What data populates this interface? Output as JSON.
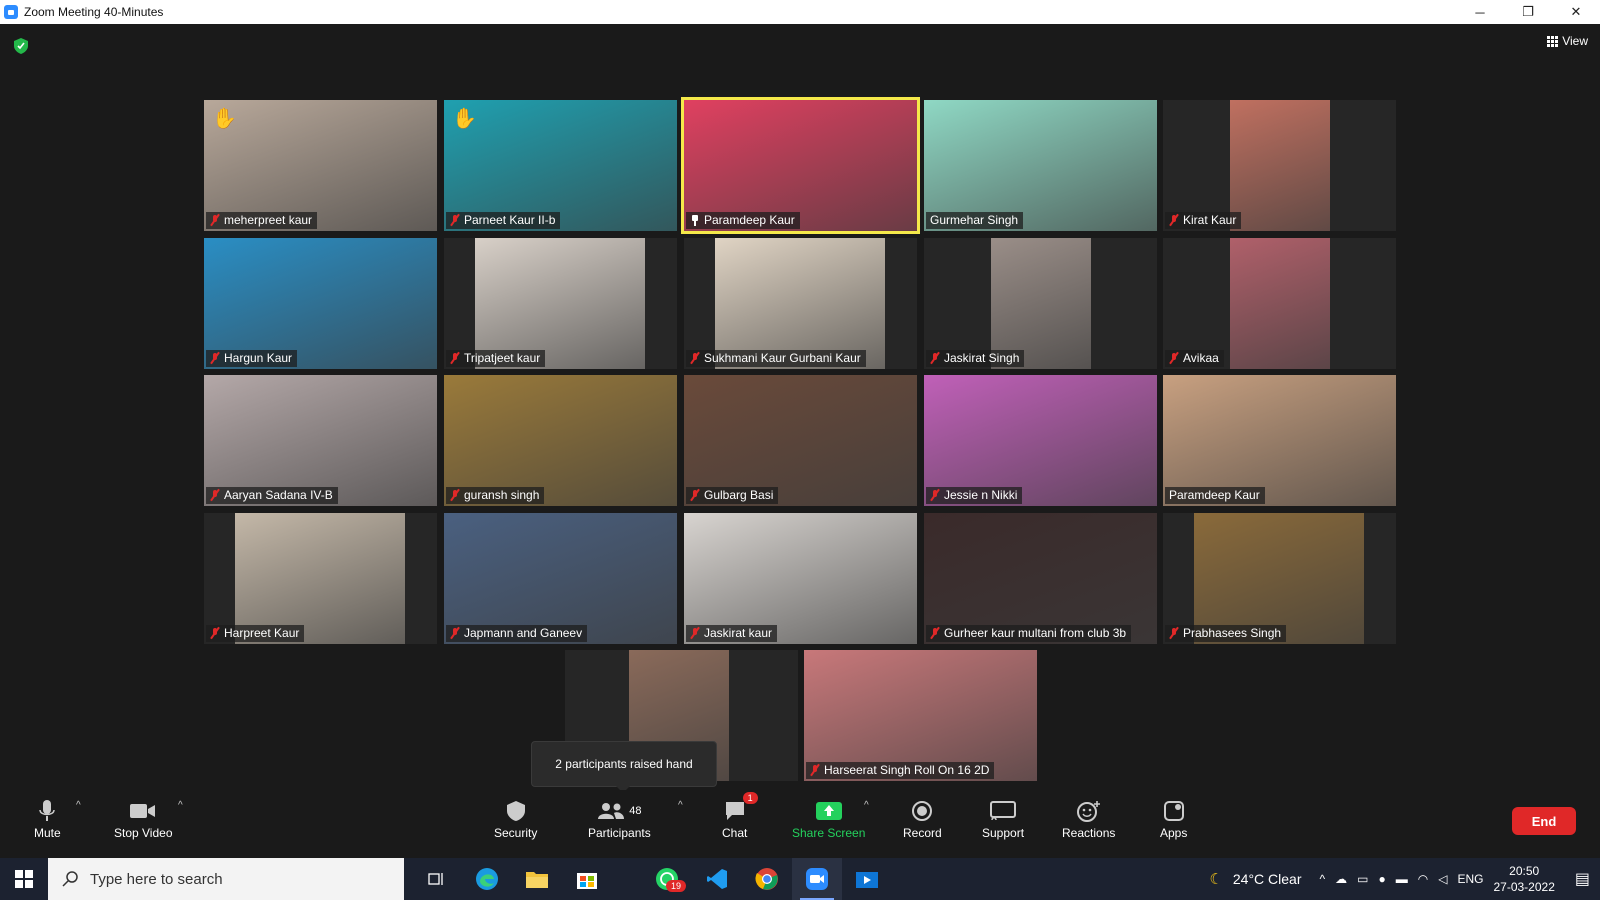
{
  "window": {
    "title": "Zoom Meeting 40-Minutes",
    "minimize": "─",
    "restore": "❐",
    "close": "✕"
  },
  "view_label": "View",
  "tiles": [
    {
      "name": "meherpreet kaur",
      "muted": true,
      "hand": true,
      "bg": "#b8a89a"
    },
    {
      "name": "Parneet Kaur II-b",
      "muted": true,
      "hand": true,
      "bg": "#1fa0b0"
    },
    {
      "name": "Paramdeep Kaur",
      "muted": false,
      "pinned": true,
      "active": true,
      "bg": "#e04060"
    },
    {
      "name": "Gurmehar Singh",
      "muted": false,
      "bg": "#8fd8c4"
    },
    {
      "name": "Kirat Kaur",
      "muted": true,
      "bg": "#c07060"
    },
    {
      "name": "Hargun Kaur",
      "muted": true,
      "bg": "#2a8ec4"
    },
    {
      "name": "Tripatjeet kaur",
      "muted": true,
      "bg": "#d8d0c8"
    },
    {
      "name": "Sukhmani Kaur Gurbani Kaur",
      "muted": true,
      "bg": "#e0d4c4"
    },
    {
      "name": "Jaskirat Singh",
      "muted": true,
      "bg": "#9a8e88"
    },
    {
      "name": "Avikaa",
      "muted": true,
      "bg": "#b0606a"
    },
    {
      "name": "Aaryan Sadana IV-B",
      "muted": true,
      "bg": "#b4a8a8"
    },
    {
      "name": "guransh singh",
      "muted": true,
      "bg": "#9a7a3a"
    },
    {
      "name": "Gulbarg Basi",
      "muted": true,
      "bg": "#6a4a3a"
    },
    {
      "name": "Jessie n Nikki",
      "muted": true,
      "bg": "#c060b8"
    },
    {
      "name": "Paramdeep Kaur",
      "muted": false,
      "bg": "#c8a080"
    },
    {
      "name": "Harpreet Kaur",
      "muted": true,
      "bg": "#c4b8a8"
    },
    {
      "name": "Japmann and Ganeev",
      "muted": true,
      "bg": "#4a6080"
    },
    {
      "name": "Jaskirat kaur",
      "muted": true,
      "bg": "#d8d4d0"
    },
    {
      "name": "Gurheer kaur multani from club 3b",
      "muted": true,
      "bg": "#3a2a2a"
    },
    {
      "name": "Prabhasees Singh",
      "muted": true,
      "bg": "#8a6a3a"
    },
    {
      "name": "",
      "muted": false,
      "bg": "#8a6a5a"
    },
    {
      "name": "Harseerat Singh Roll On 16 2D",
      "muted": true,
      "bg": "#c8787a"
    }
  ],
  "tooltip": "2 participants raised hand",
  "toolbar": {
    "mute": "Mute",
    "stop_video": "Stop Video",
    "security": "Security",
    "participants": "Participants",
    "participants_count": "48",
    "chat": "Chat",
    "chat_badge": "1",
    "share_screen": "Share Screen",
    "record": "Record",
    "support": "Support",
    "reactions": "Reactions",
    "apps": "Apps",
    "end": "End"
  },
  "taskbar": {
    "search_placeholder": "Type here to search",
    "whatsapp_badge": "19",
    "weather": "24°C  Clear",
    "lang": "ENG",
    "time": "20:50",
    "date": "27-03-2022"
  }
}
